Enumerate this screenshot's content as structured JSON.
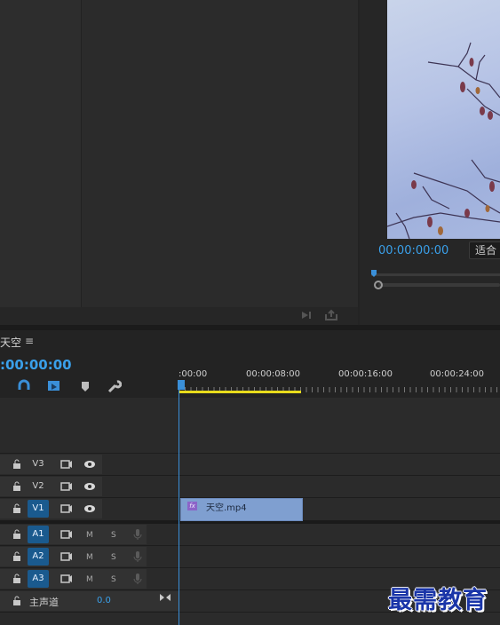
{
  "program": {
    "timecode": "00:00:00:00",
    "fit_label": "适合"
  },
  "sequence": {
    "name": "天空",
    "menu_icon": "≡",
    "timecode": ":00:00:00",
    "ruler": [
      ":00:00",
      "00:00:08:00",
      "00:00:16:00",
      "00:00:24:00"
    ]
  },
  "tracks": {
    "video": [
      {
        "name": "V3",
        "active": false
      },
      {
        "name": "V2",
        "active": false
      },
      {
        "name": "V1",
        "active": true
      }
    ],
    "audio": [
      {
        "name": "A1",
        "m": "M",
        "s": "S"
      },
      {
        "name": "A2",
        "m": "M",
        "s": "S"
      },
      {
        "name": "A3",
        "m": "M",
        "s": "S"
      }
    ],
    "master": {
      "label": "主声道",
      "value": "0.0"
    }
  },
  "clip": {
    "name": "天空.mp4",
    "fx": "fx"
  },
  "watermark": "最需教育",
  "colors": {
    "accent": "#3aa0ea",
    "clip": "#7f9fd0",
    "work_area": "#e8dc1c"
  }
}
